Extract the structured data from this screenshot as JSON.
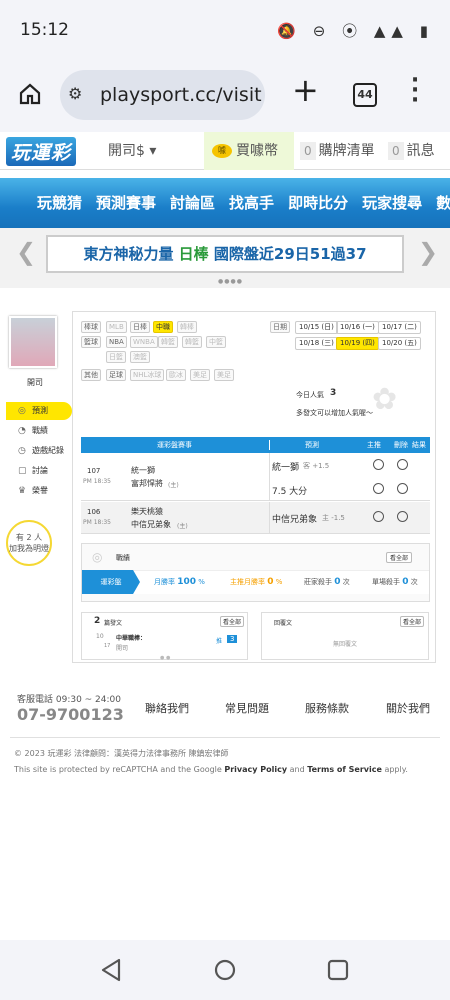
{
  "status": {
    "time": "15:12",
    "icons": "🔕 ⊖ ⦿ ▲▲ ▮"
  },
  "browser": {
    "url": "playsport.cc/visit",
    "tabs_count": "44"
  },
  "topnav": {
    "logo": "玩運彩",
    "account": "開司$",
    "buy_coins": "買噱幣",
    "coin_badge": "噱",
    "purchase_count": "0",
    "purchase_list": "購牌清單",
    "msg_count": "0",
    "messages": "訊息"
  },
  "mainmenu": [
    "玩競猜",
    "預測賽事",
    "討論區",
    "找高手",
    "即時比分",
    "玩家搜尋",
    "數據"
  ],
  "banner": {
    "part1": "東方神秘力量 ",
    "highlight": "日棒",
    "part2": " 國際盤近29日51過37"
  },
  "sidebar": {
    "username": "開司",
    "items": [
      "預測",
      "戰績",
      "遊戲紀錄",
      "討論",
      "榮譽"
    ],
    "bulb_line1": "有 2 人",
    "bulb_line2": "加我為明燈"
  },
  "filters": {
    "baseball_label": "棒球",
    "baseball": [
      "MLB",
      "日棒",
      "中職",
      "韓棒"
    ],
    "basketball_label": "籃球",
    "basketball": [
      "NBA",
      "WNBA",
      "韓籃",
      "韓籃",
      "中籃",
      "日籃",
      "澳籃"
    ],
    "other_label": "其他",
    "other": [
      "足球",
      "NHL冰球",
      "歐冰",
      "美足",
      "美足"
    ],
    "date_label": "日期",
    "dates_row1": [
      "10/15 (日)",
      "10/16 (一)",
      "10/17 (二)"
    ],
    "dates_row2": [
      "10/18 (三)",
      "10/19 (四)",
      "10/20 (五)"
    ],
    "popularity_label": "今日人氣",
    "popularity_value": "3",
    "popularity_hint": "多發文可以增加人氣喔～"
  },
  "predictions": {
    "headers": [
      "運彩盤賽事",
      "預測",
      "主推",
      "刪除",
      "結果"
    ],
    "rows": [
      {
        "no": "107",
        "time": "PM 18:35",
        "team1": "統一獅",
        "team2": "富邦悍將",
        "team2_mark": "(主)",
        "pick1": "統一獅",
        "pick1_sub": "客 +1.5",
        "pick2": "7.5 大分",
        "pick2_sub": ""
      },
      {
        "no": "106",
        "time": "PM 18:35",
        "team1": "樂天桃猿",
        "team2": "中信兄弟象",
        "team2_mark": "(主)",
        "pick1": "中信兄弟象",
        "pick1_sub": "主 -1.5",
        "pick2": "",
        "pick2_sub": ""
      }
    ]
  },
  "record": {
    "title": "戰績",
    "see_all": "看全部",
    "tab": "運彩盤",
    "month_label": "月勝率",
    "month_value": "100",
    "main_label": "主推月勝率",
    "main_value": "0",
    "win_label": "莊家殺手",
    "win_value": "0",
    "single_label": "單場殺手",
    "single_value": "0",
    "unit_pct": "%",
    "unit_times": "次"
  },
  "posts": {
    "count": "2",
    "label": "篇發文",
    "see_all": "看全部",
    "item_date_top": "10",
    "item_date_bottom": "17",
    "item_title": "中華職棒：",
    "item_author": "開司",
    "item_reply_label": "推",
    "item_reply_count": "3"
  },
  "replies": {
    "title": "回覆文",
    "see_all": "看全部",
    "empty": "無回覆文"
  },
  "footer": {
    "hotline_label": "客服電話 09:30 ~ 24:00",
    "phone": "07-9700123",
    "links": [
      "聯絡我們",
      "常見問題",
      "服務條款",
      "關於我們"
    ],
    "copyright": "© 2023 玩運彩 法律顧問：漢英得力法律事務所 陳鎮宏律師",
    "recaptcha1": "This site is protected by reCAPTCHA and the Google ",
    "privacy": "Privacy Policy",
    "and": " and ",
    "terms": "Terms of Service",
    "applies": " apply."
  },
  "colors": {
    "accent_blue": "#1e90d8",
    "highlight_yellow": "#ffe600",
    "green": "#2a9a3a"
  }
}
